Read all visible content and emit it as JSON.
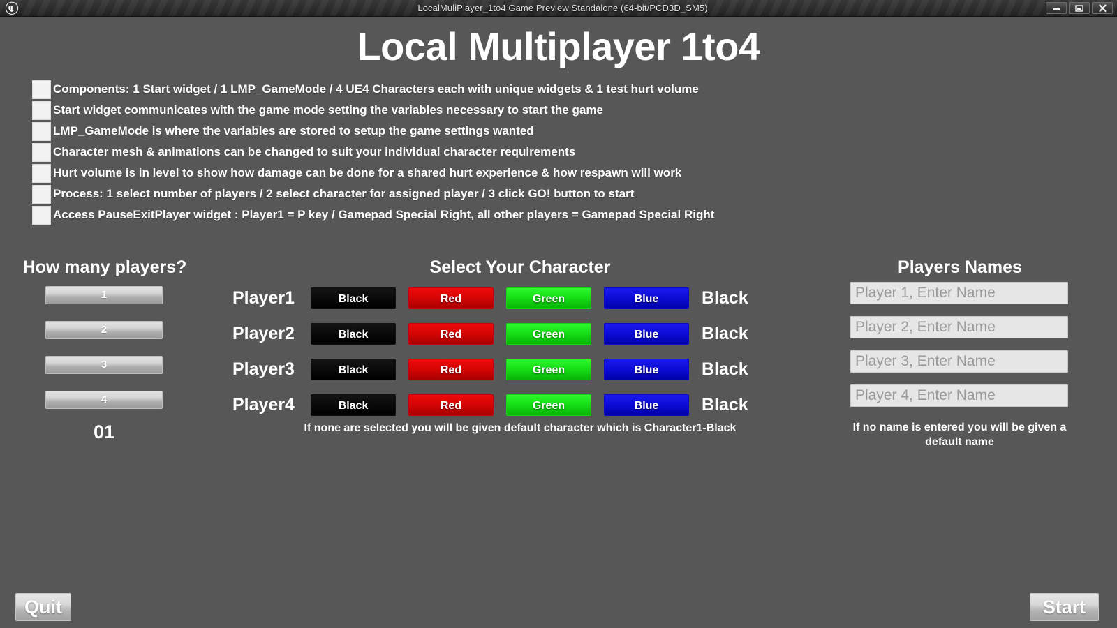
{
  "window": {
    "title": "LocalMuliPlayer_1to4 Game Preview Standalone (64-bit/PCD3D_SM5)",
    "logo_icon": "unreal-engine-logo",
    "controls": [
      {
        "name": "minimize",
        "icon": "minimize-icon"
      },
      {
        "name": "restore",
        "icon": "restore-icon"
      },
      {
        "name": "close",
        "icon": "close-icon"
      }
    ]
  },
  "page": {
    "title": "Local Multiplayer 1to4",
    "background_color": "#575757"
  },
  "bullets": [
    "Components: 1 Start widget / 1 LMP_GameMode / 4 UE4 Characters each with unique widgets & 1 test hurt volume",
    "Start widget communicates with the game mode setting the variables necessary to start the game",
    "LMP_GameMode is where the variables are stored to setup the game settings wanted",
    "Character mesh & animations can be changed to suit your individual character requirements",
    "Hurt volume is in level to show how damage can be done for a shared hurt experience & how respawn will work",
    "Process: 1 select number of players / 2 select character for assigned player / 3 click GO! button to start",
    "Access PauseExitPlayer widget : Player1 = P key / Gamepad Special Right, all other players = Gamepad Special Right"
  ],
  "player_count": {
    "heading": "How many players?",
    "options": [
      "1",
      "2",
      "3",
      "4"
    ],
    "selected_display": "01"
  },
  "character_select": {
    "heading": "Select Your Character",
    "note": "If none are selected you will be given default character which is Character1-Black",
    "colors": {
      "black": "#000000",
      "red": "#d80505",
      "green": "#16e016",
      "blue": "#0d0dd8"
    },
    "rows": [
      {
        "player": "Player1",
        "options": [
          "Black",
          "Red",
          "Green",
          "Blue"
        ],
        "current": "Black"
      },
      {
        "player": "Player2",
        "options": [
          "Black",
          "Red",
          "Green",
          "Blue"
        ],
        "current": "Black"
      },
      {
        "player": "Player3",
        "options": [
          "Black",
          "Red",
          "Green",
          "Blue"
        ],
        "current": "Black"
      },
      {
        "player": "Player4",
        "options": [
          "Black",
          "Red",
          "Green",
          "Blue"
        ],
        "current": "Black"
      }
    ]
  },
  "players_names": {
    "heading": "Players Names",
    "note": "If no name is entered you will be given a default name",
    "fields": [
      {
        "value": "",
        "placeholder": "Player 1, Enter Name"
      },
      {
        "value": "",
        "placeholder": "Player 2, Enter Name"
      },
      {
        "value": "",
        "placeholder": "Player 3, Enter Name"
      },
      {
        "value": "",
        "placeholder": "Player 4, Enter Name"
      }
    ]
  },
  "footer": {
    "quit_label": "Quit",
    "start_label": "Start"
  }
}
